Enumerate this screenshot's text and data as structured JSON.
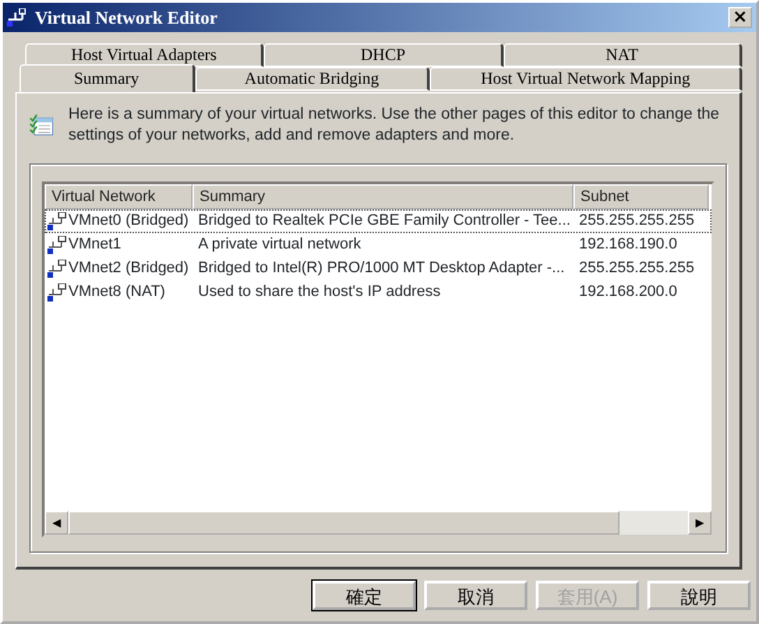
{
  "window": {
    "title": "Virtual Network Editor",
    "close": "×"
  },
  "tab_rows": [
    [
      {
        "label": "Host Virtual Adapters",
        "selected": false
      },
      {
        "label": "DHCP",
        "selected": false
      },
      {
        "label": "NAT",
        "selected": false
      }
    ],
    [
      {
        "label": "Summary",
        "selected": true
      },
      {
        "label": "Automatic Bridging",
        "selected": false
      },
      {
        "label": "Host Virtual Network Mapping",
        "selected": false
      }
    ]
  ],
  "intro": "Here is a summary of your virtual networks. Use the other pages of this editor to change the settings of your networks, add and remove adapters and more.",
  "table": {
    "columns": [
      "Virtual Network",
      "Summary",
      "Subnet"
    ],
    "rows": [
      {
        "cells": [
          "VMnet0 (Bridged)",
          "Bridged to Realtek PCIe GBE Family Controller - Tee...",
          "255.255.255.255"
        ],
        "focused": true
      },
      {
        "cells": [
          "VMnet1",
          "A private virtual network",
          "192.168.190.0"
        ],
        "focused": false
      },
      {
        "cells": [
          "VMnet2 (Bridged)",
          "Bridged to Intel(R) PRO/1000 MT Desktop Adapter -...",
          "255.255.255.255"
        ],
        "focused": false
      },
      {
        "cells": [
          "VMnet8 (NAT)",
          "Used to share the host's IP address",
          "192.168.200.0"
        ],
        "focused": false
      }
    ],
    "scroll_left": "◀",
    "scroll_right": "▶"
  },
  "buttons": [
    {
      "label": "確定",
      "default": true,
      "disabled": false
    },
    {
      "label": "取消",
      "default": false,
      "disabled": false
    },
    {
      "label": "套用(A)",
      "default": false,
      "disabled": true
    },
    {
      "label": "說明",
      "default": false,
      "disabled": false
    }
  ]
}
